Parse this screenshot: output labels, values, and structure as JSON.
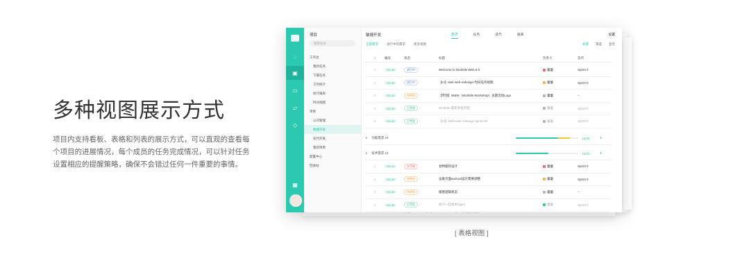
{
  "hero": {
    "title": "多种视图展示方式",
    "description": "项目内支持看板、表格和列表的展示方式，可以直观的查看每个项目的进展情况，每个成员的任务完成情况，可以针对任务设置相应的提醒策略，确保不会错过任何一件重要的事情。"
  },
  "caption": "[ 表格视图 ]",
  "app": {
    "sidebar": {
      "title": "项目",
      "search_placeholder": "搜索任务",
      "items": [
        {
          "label": "工作台",
          "type": "group"
        },
        {
          "label": "我的任务",
          "type": "sub"
        },
        {
          "label": "下属任务",
          "type": "sub"
        },
        {
          "label": "工时统计",
          "type": "sub"
        },
        {
          "label": "统计报表",
          "type": "sub"
        },
        {
          "label": "时间视图",
          "type": "sub"
        },
        {
          "label": "项目",
          "type": "group"
        },
        {
          "label": "公司管理",
          "type": "sub"
        },
        {
          "label": "敏捷开发",
          "type": "sub",
          "active": true
        },
        {
          "label": "迭代开发",
          "type": "sub"
        },
        {
          "label": "我的项目",
          "type": "sub"
        },
        {
          "label": "配置中心",
          "type": "group"
        },
        {
          "label": "回收站",
          "type": "group"
        }
      ]
    },
    "header": {
      "title": "敏捷开发",
      "tabs": [
        "需求",
        "任务",
        "迭代",
        "报表"
      ],
      "active_tab": "需求",
      "settings": "设置",
      "sub_tabs": [
        "全部需求",
        "进行中的需求",
        "更多视图"
      ],
      "new_button": "新建",
      "filter": "筛选",
      "view": "显示"
    },
    "columns": [
      "编号",
      "状态",
      "标题",
      "负责人",
      "迭代"
    ],
    "rows_top": [
      {
        "id": "DK-46",
        "status": "进行中",
        "status_color": "blue",
        "title": "Welcome to Worktile Web 8.0",
        "owner": "蕾蕾",
        "owner_color": "red",
        "sprint": "Sprint 0",
        "done": false
      },
      {
        "id": "DK-45",
        "status": "进行中",
        "status_color": "blue",
        "title": "【AI】task-web-redesign-时间任务视图",
        "owner": "蕾蕾",
        "owner_color": "yellow",
        "sprint": "Sprint 0",
        "done": false
      },
      {
        "id": "DK-44",
        "status": "待审核",
        "status_color": "orange",
        "title": "【市场】W&W（Worktile Workshop）主题活动Logo",
        "owner": "蕾蕾",
        "owner_color": "gray",
        "sprint": "--",
        "done": false
      },
      {
        "id": "DK-43",
        "status": "已完成",
        "status_color": "green",
        "title": "Worktile-最新系统开题",
        "owner": "蕾蕾",
        "owner_color": "gray",
        "sprint": "Sprint 0",
        "done": true
      },
      {
        "id": "DK-42",
        "status": "已完成",
        "status_color": "green",
        "title": "【UI】Web-task-redesign-sprint-03",
        "owner": "蕾蕾",
        "owner_color": "gray",
        "sprint": "Sprint 0",
        "done": true
      }
    ],
    "groups": [
      {
        "label": "功能需求 24",
        "progress": 0.68,
        "progress_warn": 0.18,
        "count": "12/24"
      },
      {
        "label": "技术需求 10",
        "progress": 0.52,
        "progress_warn": 0,
        "count": "12/24"
      }
    ],
    "rows_bottom": [
      {
        "id": "DK-41",
        "status": "未开始",
        "status_color": "red",
        "title": "甘特图的设计",
        "owner": "蕾蕾",
        "owner_color": "red",
        "sprint": "Sprint 0",
        "done": false
      },
      {
        "id": "DK-40",
        "status": "待审核",
        "status_color": "orange",
        "title": "设备页面android设计需要调整",
        "owner": "蕾蕾",
        "owner_color": "yellow",
        "sprint": "Sprint 0",
        "done": false
      },
      {
        "id": "DK-39",
        "status": "待审核",
        "status_color": "orange",
        "title": "版图逻辑状态",
        "owner": "蕾蕾",
        "owner_color": "gray",
        "sprint": "--",
        "done": false
      },
      {
        "id": "DK-38",
        "status": "已完成",
        "status_color": "green",
        "title": "统计一些版本bigen",
        "owner": "蕾蕾",
        "owner_color": "green",
        "sprint": "Sprint 0",
        "done": true
      }
    ],
    "peek_row": {
      "id": "DK-37",
      "status": "未开始",
      "title": "【AI】task-web-redesign-时间任务视图"
    }
  },
  "colors": {
    "accent": "#2ac9b0",
    "title": "#333333",
    "text": "#666666"
  }
}
